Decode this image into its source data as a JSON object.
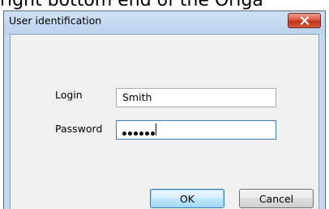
{
  "caption": {
    "text": "right bottom end of the Origa"
  },
  "dialog": {
    "title": "User identification",
    "login_label": "Login",
    "login_value": "Smith",
    "password_label": "Password",
    "password_length": 6,
    "ok_label": "OK",
    "cancel_label": "Cancel"
  },
  "icons": {
    "close": "close-icon"
  },
  "colors": {
    "titlebar": "#c3d9f0",
    "close_button": "#c7402b",
    "client_background": "#f0f0f0",
    "default_button_border": "#3c7fb1"
  }
}
